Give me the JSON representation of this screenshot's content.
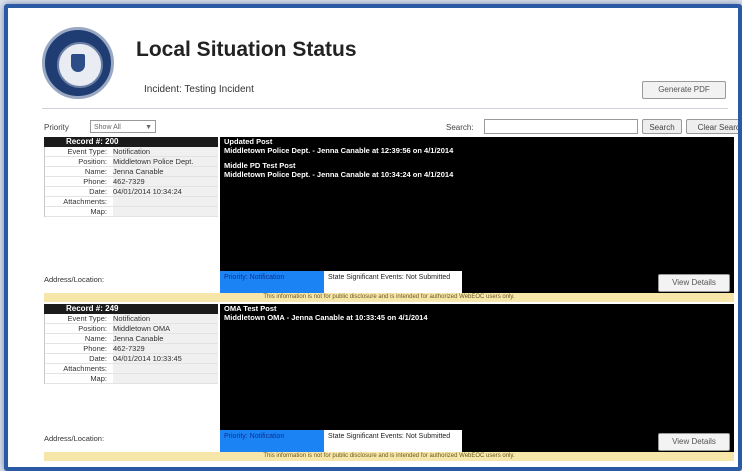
{
  "header": {
    "title": "Local Situation Status",
    "incident": "Incident: Testing Incident",
    "generate_pdf_label": "Generate PDF"
  },
  "toolbar": {
    "priority_label": "Priority",
    "priority_value": "Show All",
    "search_label": "Search:",
    "search_value": "",
    "search_button": "Search",
    "clear_search_button": "Clear Search"
  },
  "field_labels": {
    "event_type": "Event Type:",
    "position": "Position:",
    "name": "Name:",
    "phone": "Phone:",
    "date": "Date:",
    "attachments": "Attachments:",
    "map": "Map:",
    "address": "Address/Location:"
  },
  "records": [
    {
      "record_label": "Record #: 200",
      "event_type": "Notification",
      "position": "Middletown Police Dept.",
      "name": "Jenna Canable",
      "phone": "462-7329",
      "date": "04/01/2014 10:34:24",
      "posts": [
        {
          "title": "Updated Post",
          "meta": "Middletown Police Dept. - Jenna Canable at 12:39:56 on 4/1/2014"
        },
        {
          "title": "Middle PD Test Post",
          "meta": "Middletown Police Dept. - Jenna Canable at 10:34:24 on 4/1/2014"
        }
      ],
      "priority": "Priority: Notification",
      "status": "State Significant Events: Not Submitted",
      "view_details": "View Details",
      "notice": "This information is not for public disclosure and is intended for authorized WebEOC users only."
    },
    {
      "record_label": "Record #: 249",
      "event_type": "Notification",
      "position": "Middletown OMA",
      "name": "Jenna Canable",
      "phone": "462-7329",
      "date": "04/01/2014 10:33:45",
      "posts": [
        {
          "title": "OMA Test Post",
          "meta": "Middletown OMA - Jenna Canable at 10:33:45 on 4/1/2014"
        }
      ],
      "priority": "Priority: Notification",
      "status": "State Significant Events: Not Submitted",
      "view_details": "View Details",
      "notice": "This information is not for public disclosure and is intended for authorized WebEOC users only."
    }
  ]
}
